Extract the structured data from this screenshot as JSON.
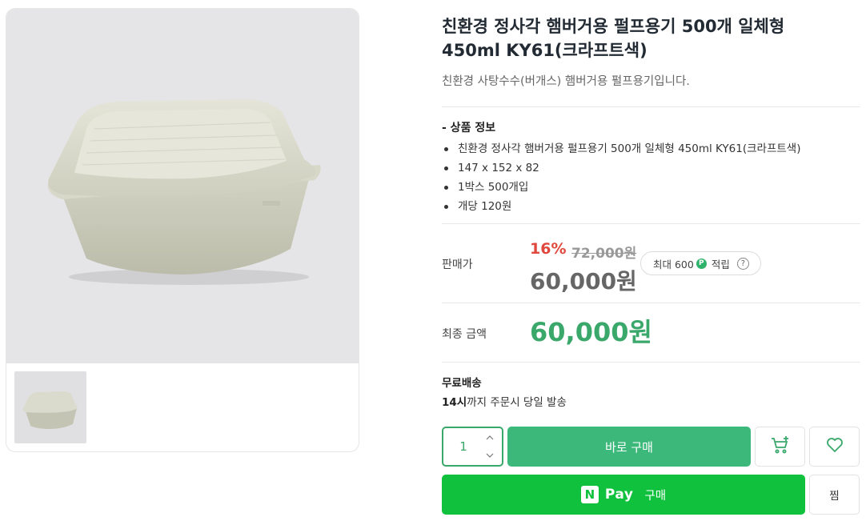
{
  "product": {
    "title": "친환경 정사각 햄버거용 펄프용기 500개 일체형 450ml KY61(크라프트색)",
    "subtitle": "친환경 사탕수수(버개스) 햄버거용 펄프용기입니다."
  },
  "info": {
    "heading": "- 상품 정보",
    "items": [
      "친환경 정사각 햄버거용 펄프용기 500개 일체형 450ml KY61(크라프트색)",
      "147 x 152 x 82",
      "1박스 500개입",
      "개당 120원"
    ]
  },
  "price": {
    "label": "판매가",
    "discount": "16%",
    "original": "72,000원",
    "sale": "60,000원",
    "points_prefix": "최대 600",
    "points_badge": "P",
    "points_suffix": "적립",
    "help": "?"
  },
  "final": {
    "label": "최종 금액",
    "amount": "60,000원"
  },
  "shipping": {
    "title": "무료배송",
    "hour": "14시",
    "desc_rest": "까지 주문시 당일 발송"
  },
  "actions": {
    "quantity": "1",
    "buy_label": "바로 구매",
    "npay_logo": "N",
    "npay_text": "Pay",
    "npay_buy": "구매",
    "jjim_label": "찜"
  },
  "colors": {
    "accent": "#3aa86b",
    "discount": "#e0483d",
    "npay": "#0fc13c"
  },
  "icons": [
    "chevron-up-icon",
    "chevron-down-icon",
    "cart-plus-icon",
    "heart-icon",
    "point-icon",
    "help-icon"
  ]
}
